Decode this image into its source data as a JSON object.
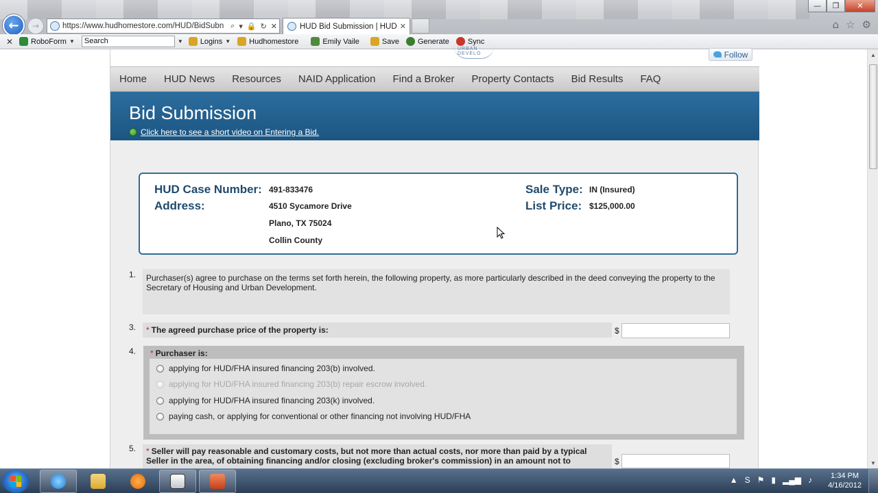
{
  "browser": {
    "address_url": "https://www.hudhomestore.com/HUD/BidSubn",
    "tab_title": "HUD Bid Submission | HUD ...",
    "window_controls": [
      "—",
      "❐",
      "✕"
    ],
    "tool_icons": [
      "home-icon",
      "favorites-star-icon",
      "settings-gear-icon"
    ]
  },
  "toolbar": {
    "close_label": "✕",
    "roboform": "RoboForm",
    "search_placeholder": "Search",
    "logins": "Logins",
    "hudhomestore": "Hudhomestore",
    "emily": "Emily Vaile",
    "save": "Save",
    "generate": "Generate",
    "sync": "Sync"
  },
  "site": {
    "follow_label": "Follow",
    "seal_text": "URBAN DEVELO",
    "nav": [
      "Home",
      "HUD News",
      "Resources",
      "NAID Application",
      "Find a Broker",
      "Property Contacts",
      "Bid Results",
      "FAQ"
    ],
    "page_title": "Bid Submission",
    "video_link": "Click here to see a short video on Entering a Bid."
  },
  "case": {
    "case_number_label": "HUD Case Number:",
    "case_number": "491-833476",
    "address_label": "Address:",
    "address_line1": "4510 Sycamore Drive",
    "address_line2": "Plano, TX 75024",
    "address_line3": "Collin County",
    "sale_type_label": "Sale Type:",
    "sale_type": "IN (Insured)",
    "list_price_label": "List Price:",
    "list_price": "$125,000.00"
  },
  "form": {
    "item1_num": "1.",
    "item1_text": "Purchaser(s) agree to purchase on the terms set forth herein, the following property, as more particularly described in the deed conveying the property to the Secretary of Housing and Urban Development.",
    "item3_num": "3.",
    "item3_text": "The agreed purchase price of the property is:",
    "currency": "$",
    "item4_num": "4.",
    "item4_title": "Purchaser is:",
    "purchaser_options": [
      {
        "label": "applying for HUD/FHA insured financing 203(b) involved.",
        "disabled": false
      },
      {
        "label": "applying for HUD/FHA insured financing 203(b) repair escrow involved.",
        "disabled": true
      },
      {
        "label": "applying for HUD/FHA insured financing 203(k) involved.",
        "disabled": false
      },
      {
        "label": "paying cash, or applying for conventional or other financing not involving HUD/FHA",
        "disabled": false
      }
    ],
    "item5_num": "5.",
    "item5_text": "Seller will pay reasonable and customary costs, but not more than actual costs, nor more than paid by a typical Seller in the area, of obtaining financing and/or closing (excluding broker's commission) in an amount not to",
    "required_mark": "*"
  },
  "taskbar": {
    "time": "1:34 PM",
    "date": "4/16/2012",
    "apps": [
      "internet-explorer",
      "file-explorer",
      "media-player",
      "snipping-tool",
      "powerpoint"
    ],
    "tray_expand": "▲"
  }
}
